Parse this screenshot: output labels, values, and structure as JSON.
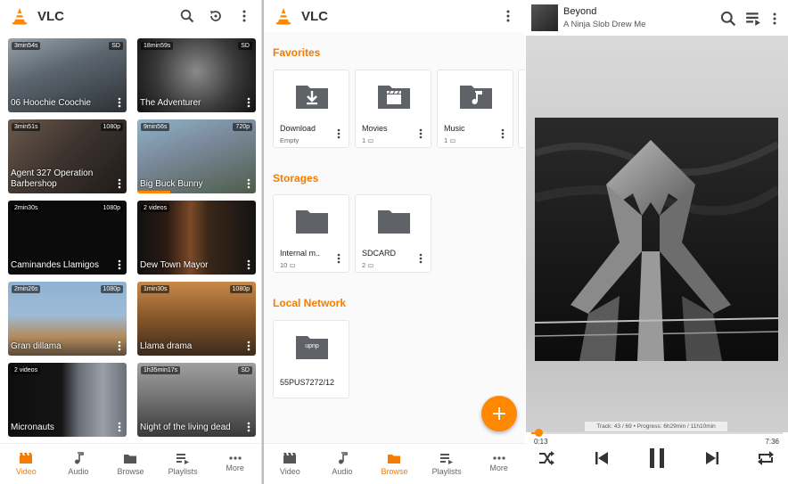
{
  "video_panel": {
    "title": "VLC",
    "videos": [
      {
        "title": "06 Hoochie Coochie",
        "duration": "3min54s",
        "res": "SD"
      },
      {
        "title": "The Adventurer",
        "duration": "18min59s",
        "res": "SD"
      },
      {
        "title": "Agent 327 Operation Barbershop",
        "duration": "3min51s",
        "res": "1080p"
      },
      {
        "title": "Big Buck Bunny",
        "duration": "9min56s",
        "res": "720p",
        "progress": 0.28
      },
      {
        "title": "Caminandes Llamigos",
        "duration": "2min30s",
        "res": "1080p"
      },
      {
        "title": "Dew Town Mayor",
        "duration": "2 videos",
        "res": ""
      },
      {
        "title": "Gran dillama",
        "duration": "2min26s",
        "res": "1080p"
      },
      {
        "title": "Llama drama",
        "duration": "1min30s",
        "res": "1080p"
      },
      {
        "title": "Micronauts",
        "duration": "2 videos",
        "res": ""
      },
      {
        "title": "Night of the living dead",
        "duration": "1h35min17s",
        "res": "SD"
      }
    ],
    "nav": [
      "Video",
      "Audio",
      "Browse",
      "Playlists",
      "More"
    ]
  },
  "browse_panel": {
    "title": "VLC",
    "favorites_heading": "Favorites",
    "storages_heading": "Storages",
    "network_heading": "Local Network",
    "favorites": [
      {
        "name": "Download",
        "sub": "Empty"
      },
      {
        "name": "Movies",
        "sub": "1"
      },
      {
        "name": "Music",
        "sub": "1"
      }
    ],
    "storages": [
      {
        "name": "Internal m..",
        "sub": "10"
      },
      {
        "name": "SDCARD",
        "sub": "2"
      }
    ],
    "network": [
      {
        "name": "55PUS7272/12",
        "folder_label": "upnp"
      }
    ],
    "nav": [
      "Video",
      "Audio",
      "Browse",
      "Playlists",
      "More"
    ]
  },
  "player_panel": {
    "song": "Beyond",
    "artist": "A Ninja Slob Drew Me",
    "track_info": "Track: 43 / 69 • Progress: 6h29min / 11h10min",
    "elapsed": "0:13",
    "total": "7:36",
    "progress": 0.028
  },
  "colors": {
    "accent": "#ff8800",
    "accent_text": "#f57c00"
  }
}
